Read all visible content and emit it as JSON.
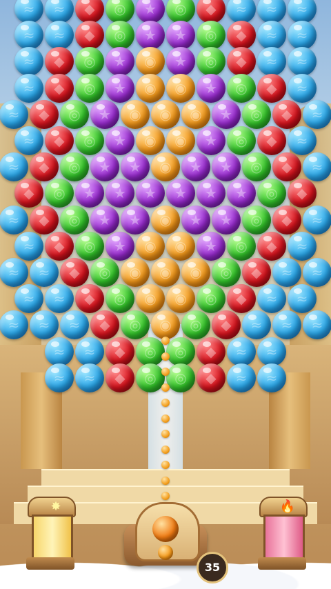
{
  "hud": {
    "shots_remaining": "35",
    "left_booster_icon": "star-burst-icon",
    "right_booster_icon": "flame-icon"
  },
  "colors": {
    "blue": "#2aa7ea",
    "red": "#d9141e",
    "green": "#33c42a",
    "purple": "#9a2cd1",
    "orange": "#f59a1b"
  },
  "shooter": {
    "current_bubble": "orange",
    "next_bubble": "orange"
  },
  "grid": [
    "BBRGPGRBBB",
    "BBRGPPGRBB",
    "BRGPOPGRBB",
    "BRGPOOPGRB",
    "BRGPOOOPGRB",
    "BRGPOOPGRB",
    "BRGPPOPPGRB",
    "RGPPPPPPGR",
    "BRGPPOPPGRB",
    "BRGPOOPGRB",
    "BBRGOOOGRBB",
    "BBRGOOGRBB",
    "BBBRGOGRBBB",
    "BBRGGRBB",
    "BBRGGRBB"
  ]
}
